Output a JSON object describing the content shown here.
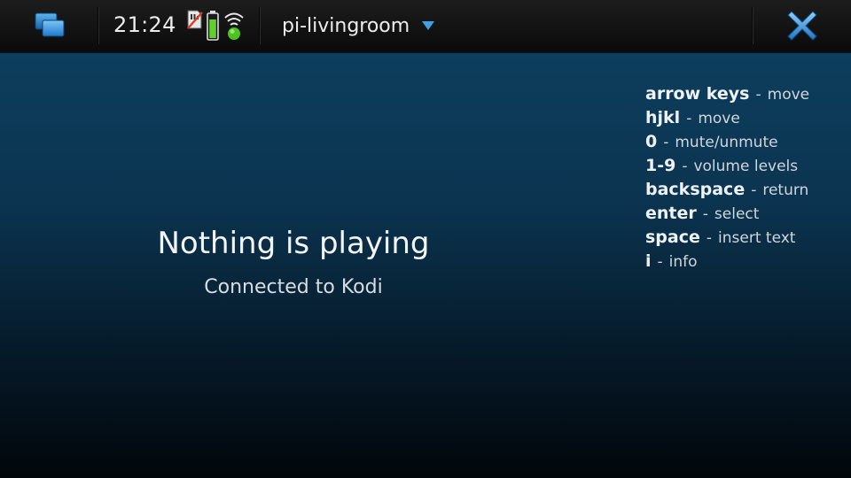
{
  "header": {
    "time": "21:24",
    "title": "pi-livingroom"
  },
  "icons": {
    "task_switcher": "task-switcher-icon",
    "sim": "sim-card-icon",
    "battery": "battery-icon",
    "wifi": "wifi-connected-icon",
    "dropdown": "dropdown-arrow-icon",
    "close": "close-icon"
  },
  "colors": {
    "accent": "#3fa0e6",
    "battery": "#5fcf2c",
    "wifi_dot": "#4fc21e"
  },
  "player": {
    "status": "Nothing is playing",
    "connection": "Connected to Kodi"
  },
  "shortcuts": [
    {
      "key": "arrow keys",
      "desc": "move"
    },
    {
      "key": "hjkl",
      "desc": "move"
    },
    {
      "key": "0",
      "desc": "mute/unmute"
    },
    {
      "key": "1-9",
      "desc": "volume levels"
    },
    {
      "key": "backspace",
      "desc": "return"
    },
    {
      "key": "enter",
      "desc": "select"
    },
    {
      "key": "space",
      "desc": "insert text"
    },
    {
      "key": "i",
      "desc": "info"
    }
  ],
  "separator": "-"
}
